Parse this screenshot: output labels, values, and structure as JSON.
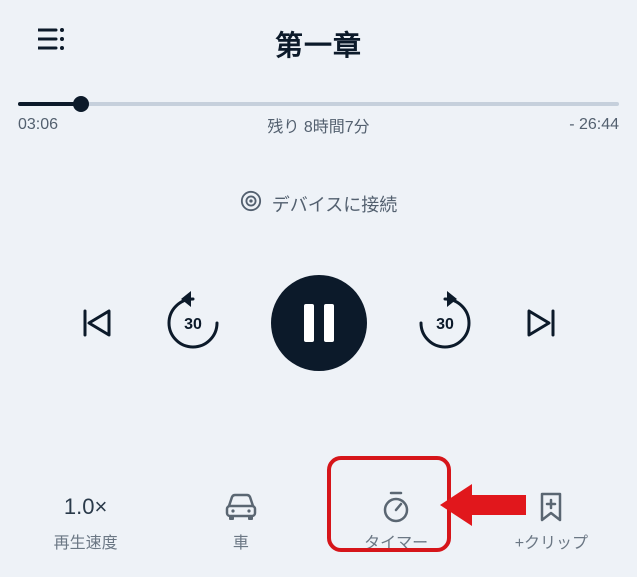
{
  "header": {
    "title": "第一章"
  },
  "progress": {
    "elapsed": "03:06",
    "remaining_overall": "残り 8時間7分",
    "remaining_chapter": "- 26:44"
  },
  "cast": {
    "label": "デバイスに接続"
  },
  "controls": {
    "rewind_seconds": "30",
    "forward_seconds": "30"
  },
  "bottom": {
    "speed_value": "1.0×",
    "speed_label": "再生速度",
    "car_label": "車",
    "timer_label": "タイマー",
    "clip_label": "+クリップ"
  }
}
